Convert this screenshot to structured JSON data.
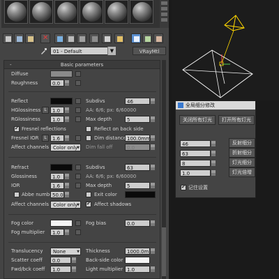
{
  "material": {
    "name": "01 - Default",
    "type": "VRayMtl",
    "rollout_title": "Basic parameters",
    "diffuse": {
      "label": "Diffuse",
      "roughness_label": "Roughness",
      "roughness": "0.0"
    },
    "reflect": {
      "label": "Reflect",
      "hglossiness_label": "HGlossiness",
      "hglossiness": "1.0",
      "rglossiness_label": "RGlossiness",
      "rglossiness": "1.0",
      "fresnel_reflections_label": "Fresnel reflections",
      "fresnel_ior_label": "Fresnel IOR",
      "fresnel_ior": "1.6",
      "subdivs_label": "Subdivs",
      "subdivs": "46",
      "aa_label": "AA: 6/6; px: 6/60000",
      "max_depth_label": "Max depth",
      "max_depth": "5",
      "reflect_backside_label": "Reflect on back side",
      "dim_distance_label": "Dim distance",
      "dim_distance": "100.0mm",
      "dim_falloff_label": "Dim fall off",
      "dim_falloff": "0.0",
      "affect_channels_label": "Affect channels",
      "affect_channels": "Color only",
      "l_label": "L"
    },
    "refract": {
      "label": "Refract",
      "glossiness_label": "Glossiness",
      "glossiness": "1.0",
      "ior_label": "IOR",
      "ior": "1.6",
      "abbe_label": "Abbe number",
      "abbe": "50.0",
      "subdivs_label": "Subdivs",
      "subdivs": "63",
      "aa_label": "AA: 6/6; px: 6/60000",
      "max_depth_label": "Max depth",
      "max_depth": "5",
      "exit_color_label": "Exit color",
      "affect_channels_label": "Affect channels",
      "affect_channels": "Color only",
      "affect_shadows_label": "Affect shadows"
    },
    "fog": {
      "color_label": "Fog color",
      "bias_label": "Fog bias",
      "bias": "0.0",
      "multiplier_label": "Fog multiplier",
      "multiplier": "1.0"
    },
    "translucency": {
      "label": "Translucency",
      "value": "None",
      "thickness_label": "Thickness",
      "thickness": "1000.0m",
      "scatter_label": "Scatter coeff",
      "scatter": "0.0",
      "back_side_color_label": "Back-side color",
      "fwd_bck_label": "Fwd/bck coeff",
      "fwd_bck": "1.0",
      "light_multiplier_label": "Light multiplier",
      "light_multiplier": "1.0"
    }
  },
  "dialog": {
    "title": "全局细分修改",
    "close_all_lights": "关闭所有灯光",
    "open_all_lights": "打开所有灯光",
    "rows": [
      {
        "value": "46",
        "button": "反射细分"
      },
      {
        "value": "63",
        "button": "折射细分"
      },
      {
        "value": "8",
        "button": "灯光细分"
      },
      {
        "value": "1.0",
        "button": "灯光倍增"
      }
    ],
    "remember_label": "记住设置"
  },
  "colors": {
    "panel_bg": "#444444",
    "accent_blue": "#5a8fd0",
    "viewport_bg": "#1c1c1c",
    "light_target": "#ffd700"
  },
  "icons": [
    "sample-sphere-icon",
    "eyedropper-icon",
    "delete-icon",
    "checkbox-icon"
  ]
}
